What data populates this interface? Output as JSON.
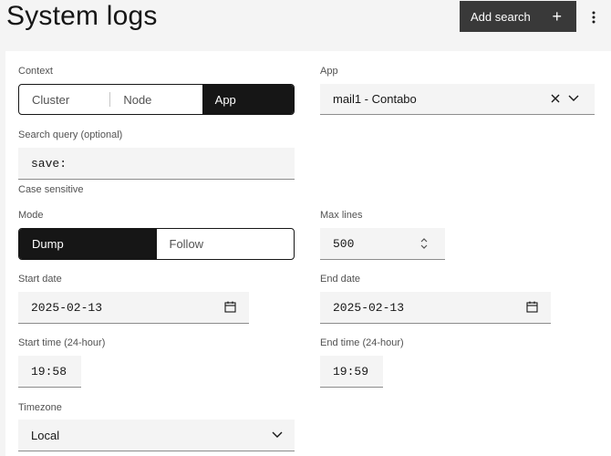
{
  "header": {
    "title": "System logs",
    "add_search_label": "Add search",
    "add_icon": "+"
  },
  "form": {
    "context": {
      "label": "Context",
      "options": [
        "Cluster",
        "Node",
        "App"
      ],
      "selected": "App"
    },
    "app": {
      "label": "App",
      "value": "mail1 - Contabo"
    },
    "search_query": {
      "label": "Search query (optional)",
      "value": "save:"
    },
    "case_sensitive": {
      "label": "Case sensitive"
    },
    "mode": {
      "label": "Mode",
      "options": [
        "Dump",
        "Follow"
      ],
      "selected": "Dump"
    },
    "max_lines": {
      "label": "Max lines",
      "value": "500"
    },
    "start_date": {
      "label": "Start date",
      "value": "2025-02-13"
    },
    "end_date": {
      "label": "End date",
      "value": "2025-02-13"
    },
    "start_time": {
      "label": "Start time (24-hour)",
      "value": "19:58"
    },
    "end_time": {
      "label": "End time (24-hour)",
      "value": "19:59"
    },
    "timezone": {
      "label": "Timezone",
      "value": "Local"
    }
  },
  "colors": {
    "accent_dark": "#161616",
    "button_bg": "#393939",
    "field_bg": "#f4f4f4",
    "label": "#525252"
  },
  "icons": {
    "add": "plus-icon",
    "overflow": "overflow-menu-vertical-icon",
    "clear": "close-icon",
    "dropdown": "chevron-down-icon",
    "calendar": "calendar-icon",
    "stepper": "stepper-icon"
  }
}
